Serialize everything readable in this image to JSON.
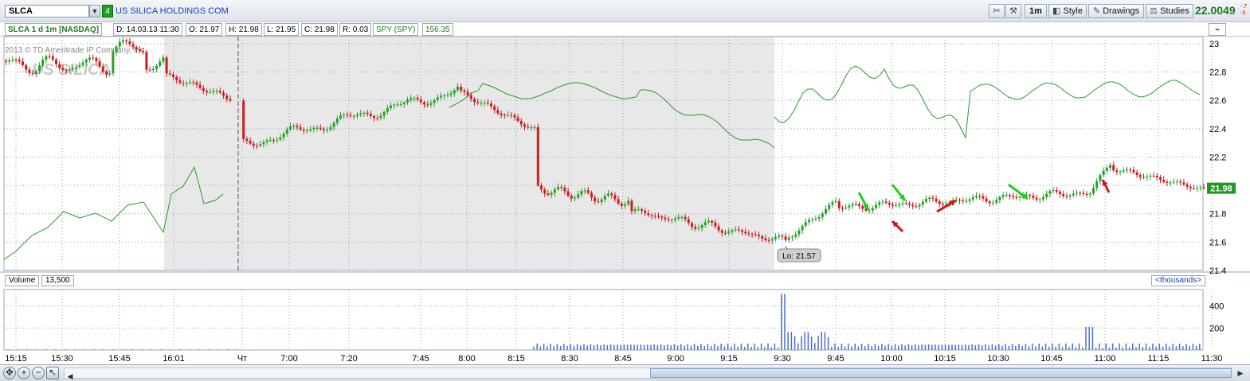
{
  "toolbar": {
    "symbol": "SLCA",
    "dropdown_arrow": "▼",
    "link_badge": "4",
    "company_name": "US SILICA HOLDINGS COM",
    "interval": "1m",
    "style_label": "Style",
    "drawings_label": "Drawings",
    "studies_label": "Studies",
    "last_price": "22.0049",
    "price_change": "-.7\n-3",
    "icons": [
      "tools-icon",
      "wrench-icon",
      "speaker-icon",
      "pencil-icon",
      "studies-icon"
    ]
  },
  "infobar": {
    "title": "SLCA 1 d 1m [NASDAQ]",
    "date": "D: 14.03.13 11:30",
    "open": "O: 21.97",
    "high": "H: 21.98",
    "low": "L: 21.95",
    "close": "C: 21.98",
    "range": "R: 0.03",
    "compare_symbol": "SPY (SPY)",
    "compare_value": "156.35"
  },
  "chart": {
    "watermark": "2013 © TD Ameritrade IP Company, Inc.",
    "logo_text": "US SILICA",
    "current_price_label": "21.98",
    "low_label": "Lo: 21.57",
    "day_marker": "Чт",
    "colors": {
      "up": "#2aa02a",
      "down": "#cc1f1f",
      "spy_line": "#2a9a2a",
      "shade": "#e8e8e8",
      "price_tag": "#1f9a1f",
      "arrow_green": "#22cc22",
      "arrow_red": "#dd1111"
    }
  },
  "chart_data": {
    "type": "candlestick",
    "y_ticks": [
      "23",
      "22.8",
      "22.6",
      "22.4",
      "22.2",
      "22",
      "21.8",
      "21.6",
      "21.4"
    ],
    "x_ticks": [
      "15:15",
      "15:30",
      "15:45",
      "16:01",
      "Чт",
      "7:00",
      "7:20",
      "7:45",
      "8:00",
      "8:15",
      "8:30",
      "8:45",
      "9:00",
      "9:15",
      "9:30",
      "9:45",
      "10:00",
      "10:15",
      "10:30",
      "10:45",
      "11:00",
      "11:15",
      "11:30"
    ],
    "ylim": [
      21.4,
      23.05
    ],
    "last": 21.98,
    "low": 21.57,
    "volume_ticks": [
      "400",
      "200"
    ],
    "volume_ylim": [
      0,
      550
    ],
    "legend": [
      "SLCA",
      "SPY (SPY)"
    ]
  },
  "volume": {
    "label": "Volume",
    "value": "13,500",
    "units": "<thousands>"
  },
  "bottom": {
    "zoom_in": "+",
    "zoom_out": "−",
    "pan": "↖",
    "left_arrow": "◀",
    "right_arrow": "▶"
  }
}
